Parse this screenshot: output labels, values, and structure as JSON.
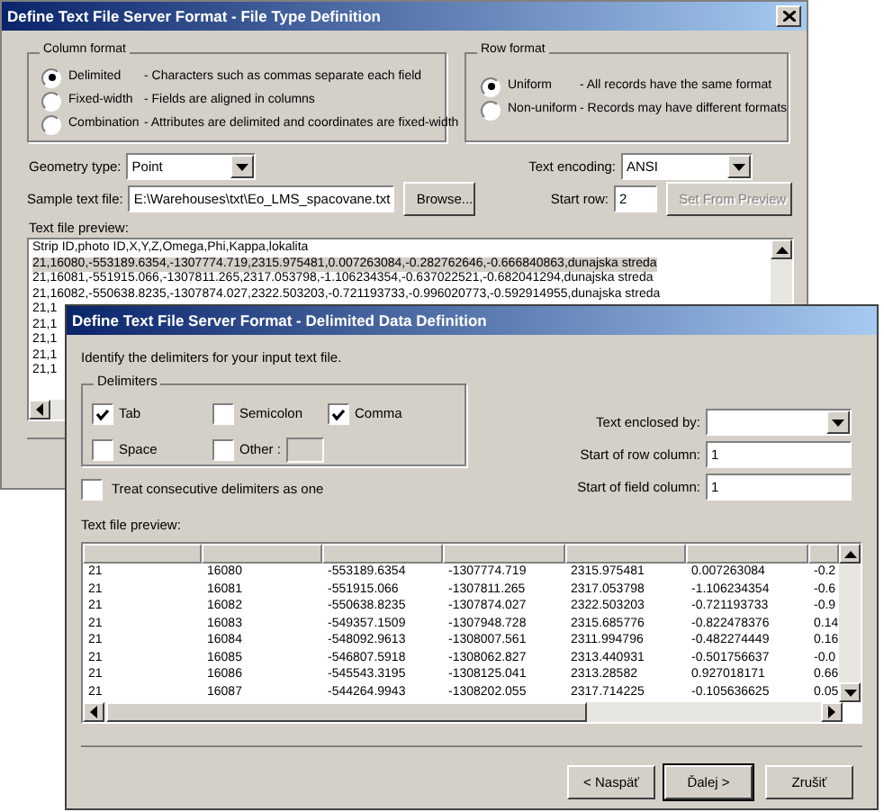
{
  "back_window": {
    "title": "Define Text File Server Format - File Type Definition",
    "column_format": {
      "label": "Column format",
      "options": [
        {
          "label": "Delimited",
          "description": "- Characters such as commas separate each field",
          "selected": true
        },
        {
          "label": "Fixed-width",
          "description": "- Fields are aligned in columns",
          "selected": false
        },
        {
          "label": "Combination",
          "description": "- Attributes are delimited and coordinates are fixed-width",
          "selected": false
        }
      ]
    },
    "row_format": {
      "label": "Row format",
      "options": [
        {
          "label": "Uniform",
          "description": "- All records have the same format",
          "selected": true
        },
        {
          "label": "Non-uniform",
          "description": "- Records may have different formats",
          "selected": false
        }
      ]
    },
    "geometry_type": {
      "label": "Geometry type:",
      "value": "Point"
    },
    "sample_text_file": {
      "label": "Sample text file:",
      "value": "E:\\Warehouses\\txt\\Eo_LMS_spacovane.txt",
      "button": "Browse..."
    },
    "text_encoding": {
      "label": "Text encoding:",
      "value": "ANSI"
    },
    "start_row": {
      "label": "Start row:",
      "value": "2",
      "button": {
        "label": "Set From Preview",
        "disabled": true
      }
    },
    "preview": {
      "label": "Text file preview:",
      "lines": [
        {
          "text": "Strip ID,photo ID,X,Y,Z,Omega,Phi,Kappa,lokalita",
          "selected": false
        },
        {
          "text": "21,16080,-553189.6354,-1307774.719,2315.975481,0.007263084,-0.282762646,-0.666840863,dunajska streda",
          "selected": true
        },
        {
          "text": "21,16081,-551915.066,-1307811.265,2317.053798,-1.106234354,-0.637022521,-0.682041294,dunajska streda",
          "selected": false
        },
        {
          "text": "21,16082,-550638.8235,-1307874.027,2322.503203,-0.721193733,-0.996020773,-0.592914955,dunajska streda",
          "selected": false
        },
        {
          "text": "21,1",
          "selected": false
        },
        {
          "text": "21,1",
          "selected": false
        },
        {
          "text": "21,1",
          "selected": false
        },
        {
          "text": "21,1",
          "selected": false
        },
        {
          "text": "21,1",
          "selected": false
        }
      ]
    }
  },
  "front_window": {
    "title": "Define Text File Server Format - Delimited Data Definition",
    "instruction": "Identify the delimiters for your input text file.",
    "delimiters": {
      "label": "Delimiters",
      "options": [
        {
          "label": "Tab",
          "checked": true
        },
        {
          "label": "Semicolon",
          "checked": false
        },
        {
          "label": "Comma",
          "checked": true
        },
        {
          "label": "Space",
          "checked": false
        },
        {
          "label": "Other :",
          "checked": false
        }
      ]
    },
    "consecutive": {
      "label": "Treat consecutive delimiters as one",
      "checked": false
    },
    "text_enclosed_by": {
      "label": "Text enclosed by:"
    },
    "start_of_row_column": {
      "label": "Start of row column:",
      "value": "1"
    },
    "start_of_field_column": {
      "label": "Start of field column:",
      "value": "1"
    },
    "preview": {
      "label": "Text file preview:",
      "rows": [
        [
          "21",
          "16080",
          "-553189.6354",
          "-1307774.719",
          "2315.975481",
          "0.007263084",
          "-0.2"
        ],
        [
          "21",
          "16081",
          "-551915.066",
          "-1307811.265",
          "2317.053798",
          "-1.106234354",
          "-0.6"
        ],
        [
          "21",
          "16082",
          "-550638.8235",
          "-1307874.027",
          "2322.503203",
          "-0.721193733",
          "-0.9"
        ],
        [
          "21",
          "16083",
          "-549357.1509",
          "-1307948.728",
          "2315.685776",
          "-0.822478376",
          "0.14"
        ],
        [
          "21",
          "16084",
          "-548092.9613",
          "-1308007.561",
          "2311.994796",
          "-0.482274449",
          "0.16"
        ],
        [
          "21",
          "16085",
          "-546807.5918",
          "-1308062.827",
          "2313.440931",
          "-0.501756637",
          "-0.0"
        ],
        [
          "21",
          "16086",
          "-545543.3195",
          "-1308125.041",
          "2313.28582",
          "0.927018171",
          "0.66"
        ],
        [
          "21",
          "16087",
          "-544264.9943",
          "-1308202.055",
          "2317.714225",
          "-0.105636625",
          "0.05"
        ]
      ]
    },
    "buttons": [
      {
        "label": "< Naspäť",
        "kind": "normal"
      },
      {
        "label": "Ďalej >",
        "kind": "default"
      },
      {
        "label": "Zrušiť",
        "kind": "normal"
      }
    ]
  }
}
